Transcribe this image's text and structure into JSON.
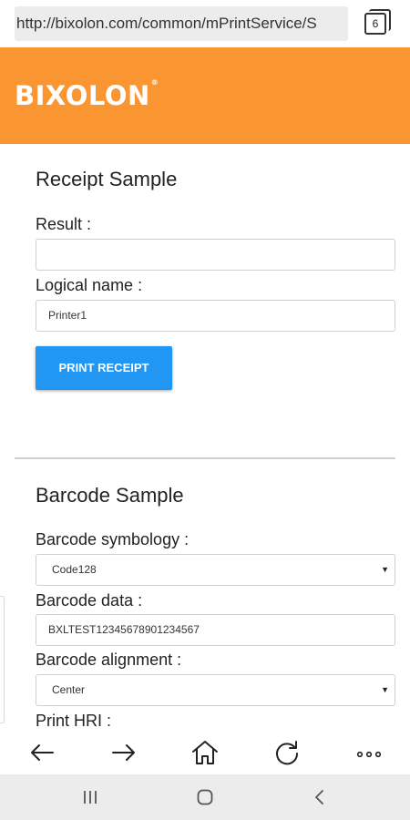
{
  "browser": {
    "url": "http://bixolon.com/common/mPrintService/S",
    "tab_count": "6"
  },
  "header": {
    "logo": "BIXOLON",
    "logo_mark": "®"
  },
  "receipt": {
    "title": "Receipt Sample",
    "result_label": "Result :",
    "result_value": "",
    "logical_name_label": "Logical name :",
    "logical_name_value": "Printer1",
    "print_button": "PRINT RECEIPT"
  },
  "barcode": {
    "title": "Barcode Sample",
    "symbology_label": "Barcode symbology :",
    "symbology_value": "Code128",
    "data_label": "Barcode data :",
    "data_value": "BXLTEST12345678901234567",
    "alignment_label": "Barcode alignment :",
    "alignment_value": "Center",
    "hri_label": "Print HRI :"
  },
  "toolbar_icons": [
    "back-icon",
    "forward-icon",
    "home-icon",
    "reload-icon",
    "more-icon"
  ],
  "nav_icons": [
    "recents-icon",
    "home-circle-icon",
    "system-back-icon"
  ],
  "colors": {
    "brand_orange": "#fa9632",
    "button_blue": "#2196f3"
  }
}
